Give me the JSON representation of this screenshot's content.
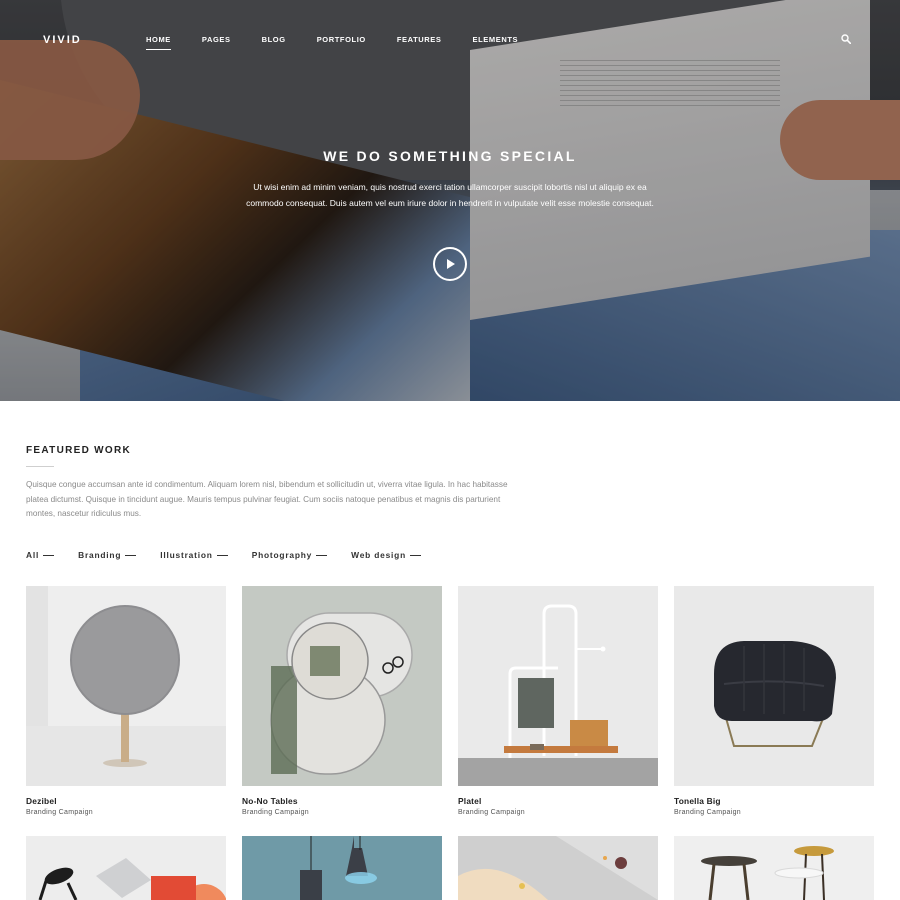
{
  "header": {
    "brand": "VIVID",
    "nav": [
      "HOME",
      "PAGES",
      "BLOG",
      "PORTFOLIO",
      "FEATURES",
      "ELEMENTS"
    ],
    "active_nav": "HOME",
    "search_icon": "search-icon"
  },
  "hero": {
    "title": "WE DO SOMETHING SPECIAL",
    "text": "Ut wisi enim ad minim veniam, quis nostrud exerci tation ullamcorper suscipit lobortis nisl ut aliquip ex ea commodo consequat. Duis autem vel eum iriure dolor in hendrerit in vulputate velit esse molestie consequat.",
    "play_icon": "play-icon"
  },
  "featured": {
    "title": "FEATURED WORK",
    "description": "Quisque congue accumsan ante id condimentum. Aliquam lorem nisl, bibendum et sollicitudin ut, viverra vitae ligula. In hac habitasse platea dictumst. Quisque in tincidunt augue. Mauris tempus pulvinar feugiat. Cum sociis natoque penatibus et magnis dis parturient montes, nascetur ridiculus mus.",
    "filters": [
      "All",
      "Branding",
      "Illustration",
      "Photography",
      "Web design"
    ]
  },
  "portfolio": [
    {
      "title": "Dezibel",
      "subtitle": "Branding Campaign"
    },
    {
      "title": "No-No Tables",
      "subtitle": "Branding Campaign"
    },
    {
      "title": "Platel",
      "subtitle": "Branding Campaign"
    },
    {
      "title": "Tonella Big",
      "subtitle": "Branding Campaign"
    }
  ],
  "colors": {
    "accent": "#222222",
    "muted_text": "#8a8a8a",
    "hero_overlay": "#000000"
  }
}
